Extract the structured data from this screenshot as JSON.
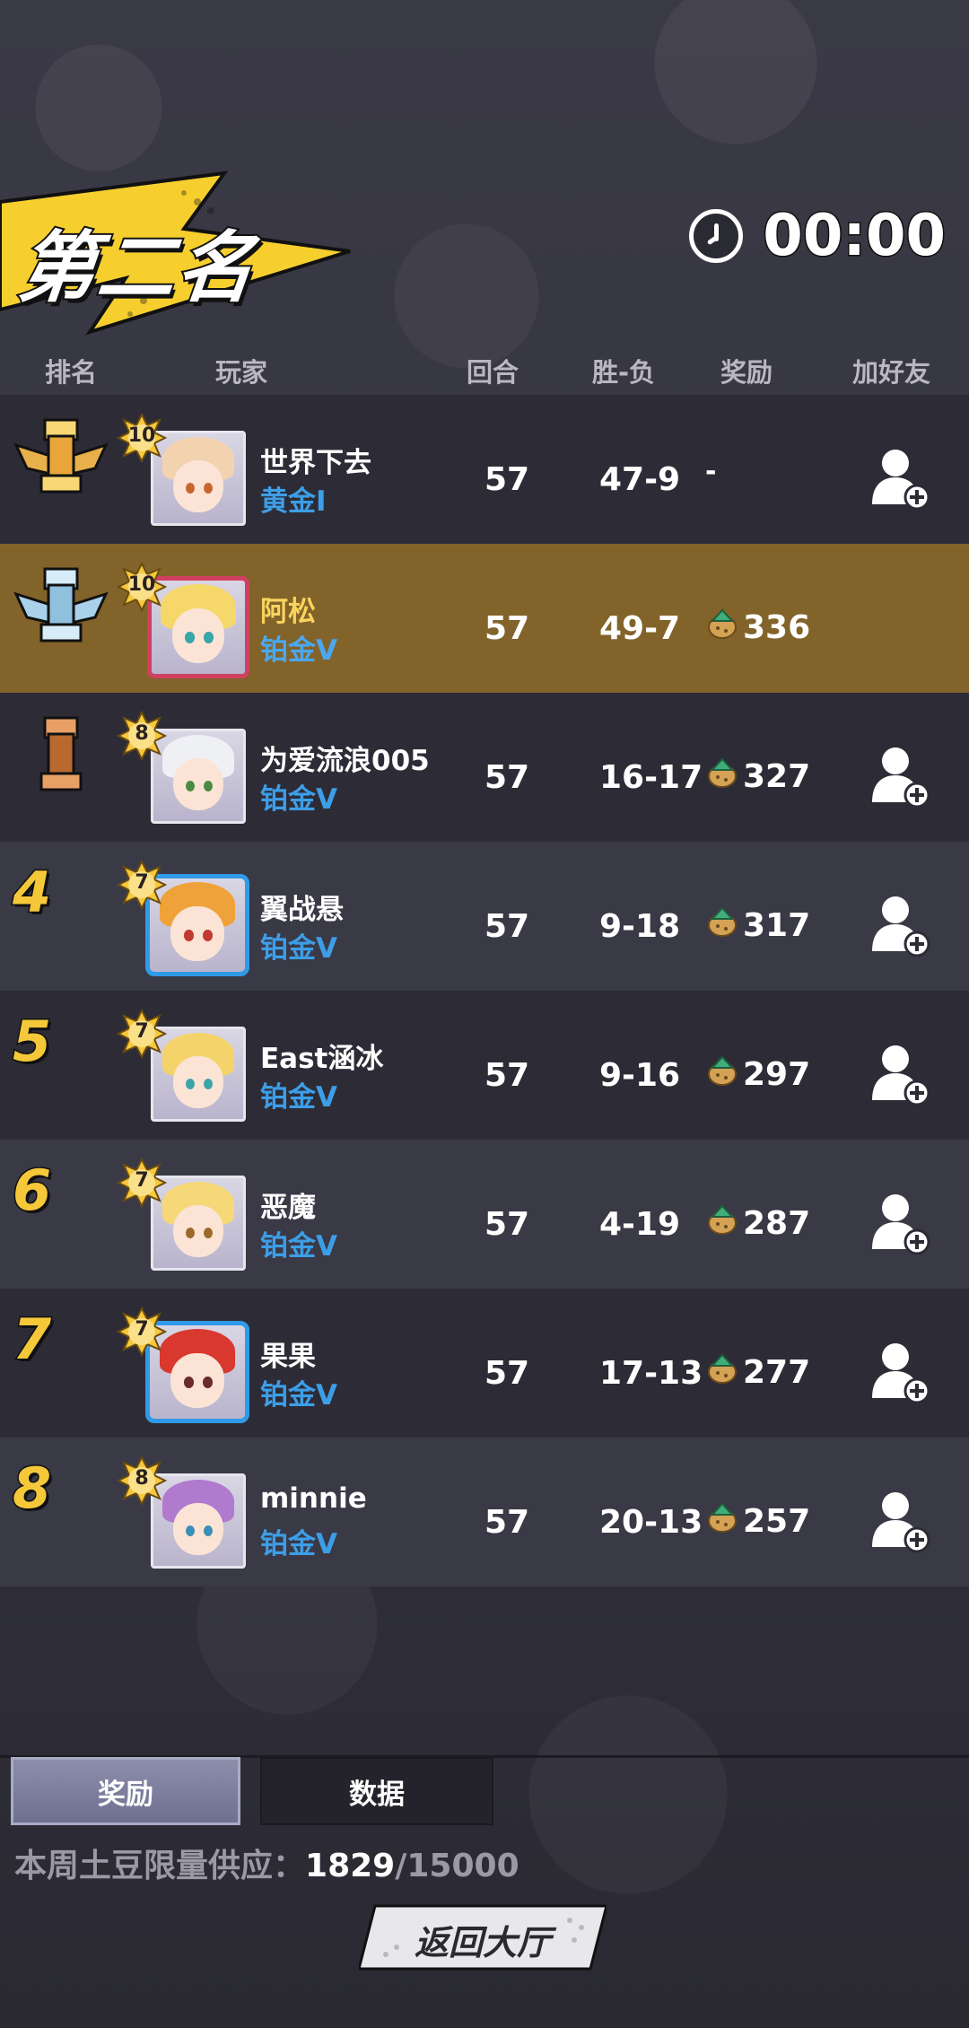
{
  "header": {
    "rank_title": "第二名",
    "timer": "00:00"
  },
  "columns": {
    "rank": "排名",
    "player": "玩家",
    "rounds": "回合",
    "win_loss": "胜-负",
    "reward": "奖励",
    "add_friend": "加好友"
  },
  "rows": [
    {
      "rank": "1",
      "trophy": "gold",
      "level": "10",
      "name": "世界下去",
      "tier": "黄金I",
      "rounds": "57",
      "win_loss": "47-9",
      "reward": "-",
      "avatar_hair": "#f3d2b0",
      "avatar_eye": "#c9652f",
      "frame": "plain"
    },
    {
      "rank": "2",
      "trophy": "silver",
      "level": "10",
      "name": "阿松",
      "tier": "铂金V",
      "rounds": "57",
      "win_loss": "49-7",
      "reward": "336",
      "avatar_hair": "#f6d86a",
      "avatar_eye": "#3aa5a8",
      "frame": "pinkframe",
      "highlight": true
    },
    {
      "rank": "3",
      "trophy": "bronze",
      "level": "8",
      "name": "为爱流浪005",
      "tier": "铂金V",
      "rounds": "57",
      "win_loss": "16-17",
      "reward": "327",
      "avatar_hair": "#eef0f3",
      "avatar_eye": "#4a8a45",
      "frame": "plain"
    },
    {
      "rank": "4",
      "level": "7",
      "name": "翼战悬",
      "tier": "铂金V",
      "rounds": "57",
      "win_loss": "9-18",
      "reward": "317",
      "avatar_hair": "#f0a23a",
      "avatar_eye": "#c03a30",
      "frame": "blue"
    },
    {
      "rank": "5",
      "level": "7",
      "name": "East涵冰",
      "tier": "铂金V",
      "rounds": "57",
      "win_loss": "9-16",
      "reward": "297",
      "avatar_hair": "#f4d46a",
      "avatar_eye": "#3aa5a8",
      "frame": "plain"
    },
    {
      "rank": "6",
      "level": "7",
      "name": "恶魔",
      "tier": "铂金V",
      "rounds": "57",
      "win_loss": "4-19",
      "reward": "287",
      "avatar_hair": "#f6d879",
      "avatar_eye": "#9b6a2a",
      "frame": "plain"
    },
    {
      "rank": "7",
      "level": "7",
      "name": "果果",
      "tier": "铂金V",
      "rounds": "57",
      "win_loss": "17-13",
      "reward": "277",
      "avatar_hair": "#d9382f",
      "avatar_eye": "#6a2a2a",
      "frame": "blue"
    },
    {
      "rank": "8",
      "level": "8",
      "name": "minnie",
      "tier": "铂金V",
      "rounds": "57",
      "win_loss": "20-13",
      "reward": "257",
      "avatar_hair": "#b07bcf",
      "avatar_eye": "#3a8fb8",
      "frame": "plain"
    }
  ],
  "tabs": {
    "reward": "奖励",
    "data": "数据"
  },
  "supply": {
    "label": "本周土豆限量供应：",
    "current": "1829",
    "separator": "/",
    "max": "15000"
  },
  "return_button": "返回大厅",
  "colors": {
    "gold_rank": "#f5c83a",
    "tier_blue": "#3d9ee8",
    "highlight_row": "#82632a"
  }
}
